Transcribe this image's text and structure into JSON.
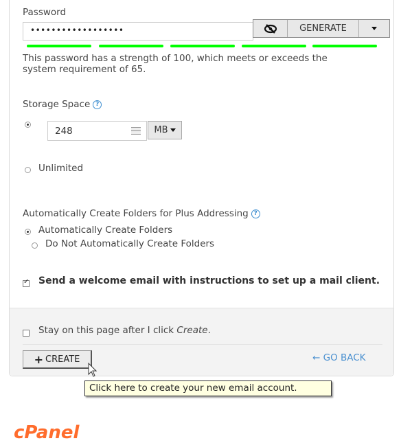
{
  "password": {
    "label": "Password",
    "value": "••••••••••••••••••",
    "toggle_visibility_icon": "eye-slash-icon",
    "generate_label": "GENERATE",
    "dropdown_icon": "caret-down-icon",
    "strength_bars": 5,
    "strength_filled": 5,
    "strength_color": "#00ff00",
    "strength_message": "This password has a strength of 100, which meets or exceeds the",
    "strength_message_2": "system requirement of 65."
  },
  "storage": {
    "label": "Storage Space",
    "help_icon": "?",
    "quota_value": "248",
    "unit": "MB",
    "unit_caret": "▾",
    "unlimited_label": "Unlimited",
    "selected": "quota"
  },
  "plus_addressing": {
    "label": "Automatically Create Folders for Plus Addressing",
    "help_icon": "?",
    "options": [
      "Automatically Create Folders",
      "Do Not Automatically Create Folders"
    ],
    "selected_index": 0
  },
  "welcome_email": {
    "label": "Send a welcome email with instructions to set up a mail client.",
    "checked": true
  },
  "footer": {
    "stay_label_prefix": "Stay on this page after I click ",
    "stay_label_em": "Create",
    "stay_label_suffix": ".",
    "stay_checked": false,
    "create_icon": "+",
    "create_label": "CREATE",
    "go_back_icon": "←",
    "go_back_label": "GO BACK"
  },
  "tooltip": "Click here to create your new email account.",
  "logo": "cPanel"
}
